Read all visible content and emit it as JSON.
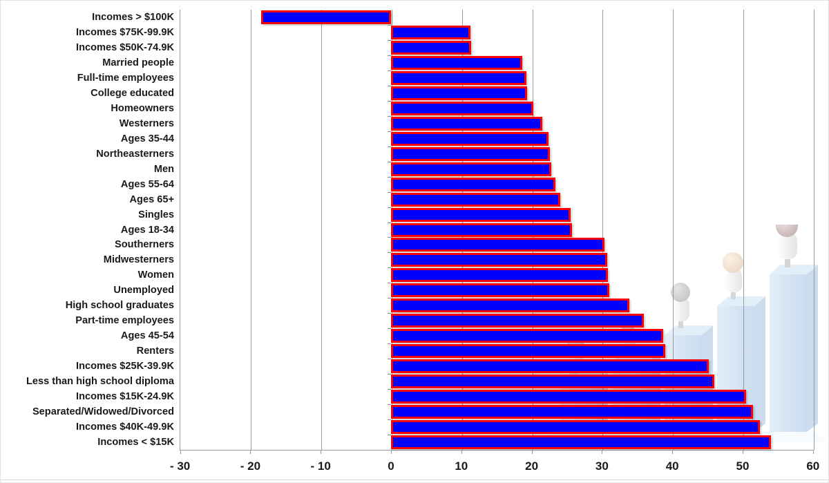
{
  "chart_data": {
    "type": "bar",
    "orientation": "horizontal",
    "title": "",
    "subtitle": "",
    "xlabel": "",
    "ylabel": "",
    "xlim": [
      -30,
      60
    ],
    "xticks": [
      -30,
      -20,
      -10,
      0,
      10,
      20,
      30,
      40,
      50,
      60
    ],
    "xticklabels": [
      "- 30",
      "- 20",
      "- 10",
      "0",
      "10",
      "20",
      "30",
      "40",
      "50",
      "60"
    ],
    "grid": true,
    "grid_axis": "x",
    "legend": "none",
    "bar_fill_color": "#0000FF",
    "bar_border_color": "#FF0000",
    "gridline_color": "#9A9A9A",
    "categories": [
      "Incomes > $100K",
      "Incomes $75K-99.9K",
      "Incomes $50K-74.9K",
      "Married people",
      "Full-time employees",
      "College educated",
      "Homeowners",
      "Westerners",
      "Ages 35-44",
      "Northeasterners",
      "Men",
      "Ages 55-64",
      "Ages 65+",
      "Singles",
      "Ages 18-34",
      "Southerners",
      "Midwesterners",
      "Women",
      "Unemployed",
      "High school graduates",
      "Part-time employees",
      "Ages 45-54",
      "Renters",
      "Incomes $25K-39.9K",
      "Less than high school diploma",
      "Incomes $15K-24.9K",
      "Separated/Widowed/Divorced",
      "Incomes $40K-49.9K",
      "Incomes < $15K"
    ],
    "values": [
      -18.5,
      11.3,
      11.4,
      18.7,
      19.3,
      19.4,
      20.2,
      21.5,
      22.4,
      22.6,
      22.8,
      23.4,
      24.1,
      25.5,
      25.7,
      30.4,
      30.7,
      30.8,
      31.0,
      33.9,
      36.0,
      38.7,
      39.0,
      45.2,
      46.0,
      50.5,
      51.5,
      52.5,
      54.0
    ]
  },
  "background_art": {
    "name": "3d-bar-chart-with-people",
    "bar_color": "#8FB8E0",
    "figure_count": 5,
    "head_colors": [
      "#A9A9A9",
      "#C88C98",
      "#8C8C8C",
      "#E8B98E",
      "#7B4A4A"
    ]
  }
}
